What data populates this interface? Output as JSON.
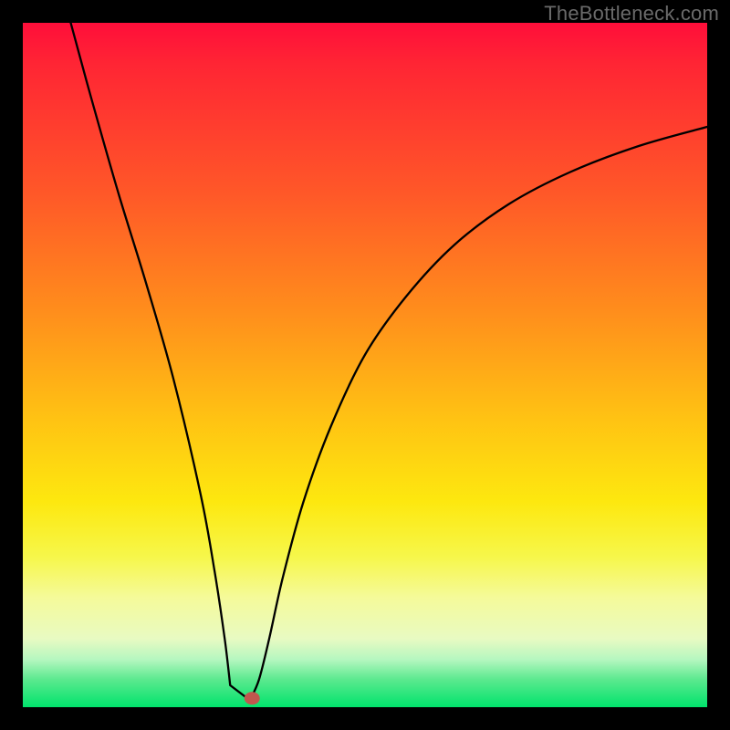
{
  "watermark": "TheBottleneck.com",
  "colors": {
    "frame": "#000000",
    "curve": "#000000",
    "marker_fill": "#c0574e",
    "marker_stroke": "#9a3e38",
    "gradient_top": "#ff0e3a",
    "gradient_bottom": "#00e36c"
  },
  "chart_data": {
    "type": "line",
    "title": "",
    "xlabel": "",
    "ylabel": "",
    "xlim": [
      0,
      100
    ],
    "ylim": [
      0,
      100
    ],
    "grid": false,
    "legend": false,
    "series": [
      {
        "name": "curve",
        "x": [
          7,
          10,
          14,
          18,
          22,
          26,
          28,
          29.5,
          30.3,
          31,
          32,
          33.2,
          34.5,
          36,
          38,
          41,
          45,
          50,
          56,
          63,
          71,
          80,
          90,
          100
        ],
        "y": [
          100,
          89,
          75,
          62,
          48,
          31,
          20,
          10,
          3.2,
          1,
          1,
          1.1,
          4,
          10,
          19,
          30,
          41,
          51.5,
          60,
          67.5,
          73.5,
          78.2,
          82,
          84.8
        ]
      }
    ],
    "flat_bottom": {
      "x_start": 30.3,
      "x_end": 33.2,
      "y": 1
    },
    "marker": {
      "x": 33.5,
      "y": 1.3
    },
    "notes": "Values are percentages of the plot area; y=0 at bottom (green) and y=100 at top (red). The black curve descends steeply from the top-left, has a short flat minimum near the bottom around x≈30–33, then rises with a concave shape toward the right."
  }
}
